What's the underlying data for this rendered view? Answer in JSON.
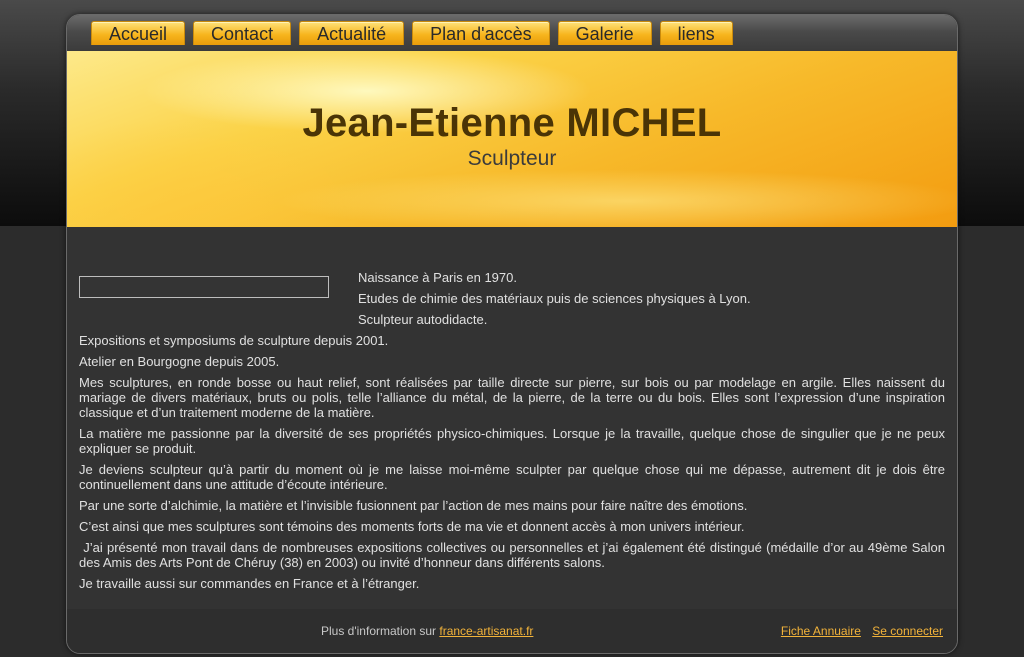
{
  "nav": {
    "items": [
      {
        "label": "Accueil"
      },
      {
        "label": "Contact"
      },
      {
        "label": "Actualité"
      },
      {
        "label": "Plan d'accès"
      },
      {
        "label": "Galerie"
      },
      {
        "label": "liens"
      }
    ]
  },
  "header": {
    "title": "Jean-Etienne MICHEL",
    "subtitle": "Sculpteur"
  },
  "content": {
    "paragraphs": [
      "Naissance à Paris en 1970.",
      "Etudes de chimie des matériaux puis de sciences physiques à Lyon.",
      "Sculpteur autodidacte.",
      "Expositions et symposiums de sculpture depuis 2001.",
      "Atelier en Bourgogne depuis 2005.",
      "Mes sculptures, en ronde bosse ou haut relief, sont réalisées par taille directe sur pierre, sur bois ou par modelage en argile. Elles naissent du mariage de divers matériaux, bruts ou polis, telle l’alliance du métal, de la pierre, de la terre ou du bois. Elles sont l’expression d’une inspiration classique et d’un traitement moderne de la matière.",
      "La matière me passionne par la diversité de ses propriétés physico-chimiques. Lorsque je la travaille, quelque chose de singulier que je ne peux expliquer se produit.",
      "Je deviens sculpteur qu’à partir du moment où je me laisse moi-même sculpter par quelque chose qui me dépasse, autrement dit je dois être continuellement dans une attitude d’écoute intérieure.",
      "Par une sorte d’alchimie, la matière et l’invisible fusionnent par l’action de mes mains pour faire naître des émotions.",
      "C’est ainsi que mes sculptures sont témoins des moments forts de ma vie et donnent accès à mon univers intérieur.",
      " J’ai présenté mon travail dans de nombreuses expositions collectives ou personnelles et j’ai également été distingué (médaille d’or au 49ème Salon des Amis des Arts Pont de Chéruy (38) en 2003) ou invité d’honneur dans différents salons.",
      "Je travaille aussi sur commandes en France et à l’étranger."
    ]
  },
  "footer": {
    "info_text": "Plus d'information sur",
    "info_link": "france-artisanat.fr",
    "fiche_link": "Fiche Annuaire",
    "login_link": "Se connecter"
  },
  "colors": {
    "accent": "#f7b51e",
    "link": "#f2b33a",
    "title": "#4a3406",
    "background": "#2c2c2c"
  }
}
